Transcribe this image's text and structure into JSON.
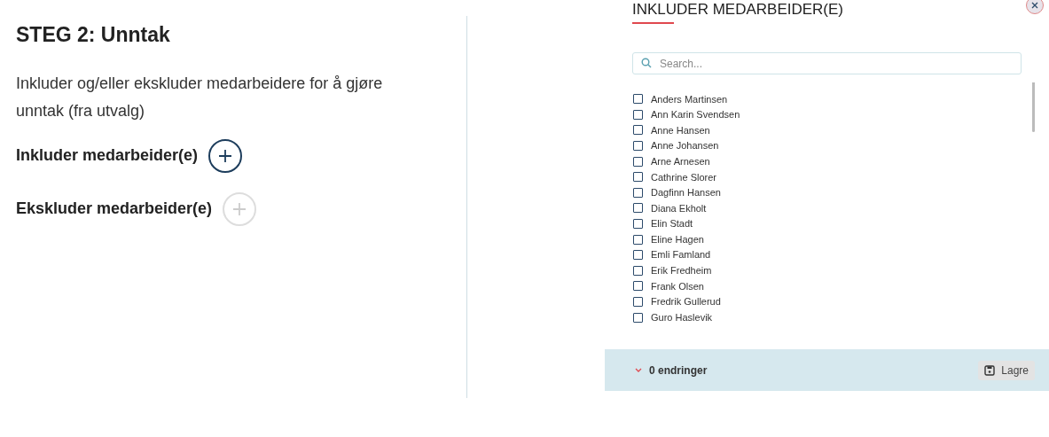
{
  "step": {
    "title": "STEG 2: Unntak",
    "description": "Inkluder og/eller ekskluder medarbeidere for å gjøre unntak (fra utvalg)",
    "actions": [
      {
        "label": "Inkluder medarbeider(e)",
        "disabled": false
      },
      {
        "label": "Ekskluder medarbeider(e)",
        "disabled": true
      }
    ]
  },
  "dialog": {
    "title": "INKLUDER MEDARBEIDER(E)",
    "search": {
      "placeholder": "Search..."
    },
    "employees": [
      {
        "name": "Anders Martinsen",
        "checked": false
      },
      {
        "name": "Ann Karin Svendsen",
        "checked": false
      },
      {
        "name": "Anne Hansen",
        "checked": false
      },
      {
        "name": "Anne Johansen",
        "checked": false
      },
      {
        "name": "Arne Arnesen",
        "checked": false
      },
      {
        "name": "Cathrine Slorer",
        "checked": false
      },
      {
        "name": "Dagfinn Hansen",
        "checked": false
      },
      {
        "name": "Diana Ekholt",
        "checked": false
      },
      {
        "name": "Elin Stadt",
        "checked": false
      },
      {
        "name": "Eline Hagen",
        "checked": false
      },
      {
        "name": "Emli Famland",
        "checked": false
      },
      {
        "name": "Erik Fredheim",
        "checked": false
      },
      {
        "name": "Frank Olsen",
        "checked": false
      },
      {
        "name": "Fredrik Gullerud",
        "checked": false
      },
      {
        "name": "Guro Haslevik",
        "checked": false
      }
    ],
    "footer": {
      "changes": "0 endringer",
      "save": "Lagre"
    }
  }
}
